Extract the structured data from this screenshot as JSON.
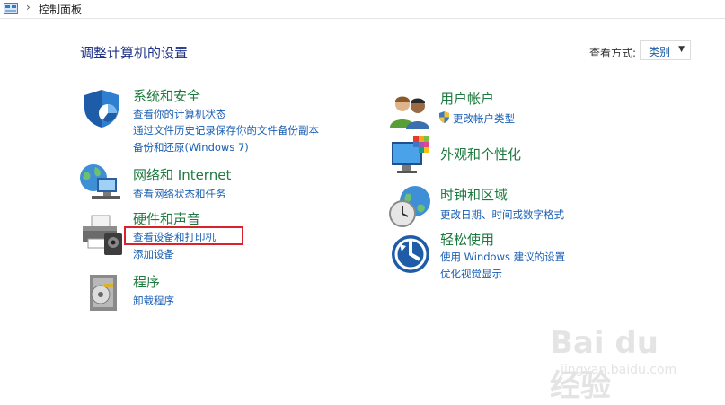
{
  "address_bar": {
    "path": "控制面板"
  },
  "page_title": "调整计算机的设置",
  "view_by": {
    "label": "查看方式:",
    "value": "类别"
  },
  "left_categories": [
    {
      "title": "系统和安全",
      "links": [
        "查看你的计算机状态",
        "通过文件历史记录保存你的文件备份副本",
        "备份和还原(Windows 7)"
      ]
    },
    {
      "title": "网络和 Internet",
      "links": [
        "查看网络状态和任务"
      ]
    },
    {
      "title": "硬件和声音",
      "links": [
        "查看设备和打印机",
        "添加设备"
      ]
    },
    {
      "title": "程序",
      "links": [
        "卸载程序"
      ]
    }
  ],
  "right_categories": [
    {
      "title": "用户帐户",
      "links": [
        "更改帐户类型"
      ]
    },
    {
      "title": "外观和个性化",
      "links": []
    },
    {
      "title": "时钟和区域",
      "links": [
        "更改日期、时间或数字格式"
      ]
    },
    {
      "title": "轻松使用",
      "links": [
        "使用 Windows 建议的设置",
        "优化视觉显示"
      ]
    }
  ],
  "watermark": {
    "brand": "Bai du 经验",
    "url": "jingyan.baidu.com"
  },
  "colors": {
    "title": "#1e3287",
    "category": "#1e7a3e",
    "link": "#1a5fb4",
    "highlight": "#d9232a"
  }
}
